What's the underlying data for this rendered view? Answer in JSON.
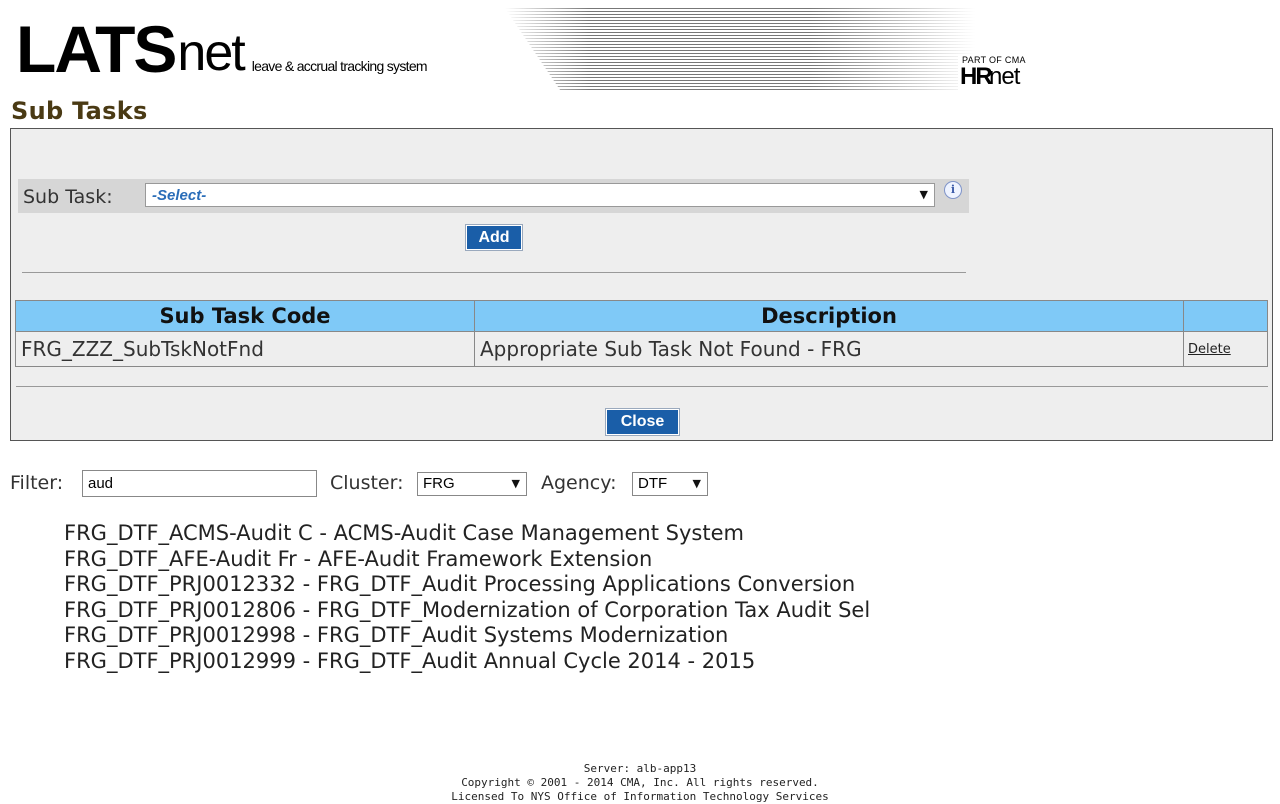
{
  "header": {
    "logo_lats": "LATS",
    "logo_net": "net",
    "tagline": "leave & accrual tracking system",
    "part_of": "PART OF CMA",
    "hr": "HR",
    "hr_net": "net"
  },
  "page_title": "Sub Tasks",
  "subtask": {
    "label": "Sub Task:",
    "selected": "-Select-",
    "add_button": "Add"
  },
  "table": {
    "columns": [
      "Sub Task Code",
      "Description",
      ""
    ],
    "rows": [
      {
        "code": "FRG_ZZZ_SubTskNotFnd",
        "description": "Appropriate Sub Task Not Found - FRG",
        "action": "Delete"
      }
    ]
  },
  "close_button": "Close",
  "filter": {
    "label": "Filter:",
    "value": "aud",
    "cluster_label": "Cluster:",
    "cluster_value": "FRG",
    "agency_label": "Agency:",
    "agency_value": "DTF"
  },
  "results": [
    "FRG_DTF_ACMS-Audit C - ACMS-Audit Case Management System",
    "FRG_DTF_AFE-Audit Fr - AFE-Audit Framework Extension",
    "FRG_DTF_PRJ0012332 - FRG_DTF_Audit Processing Applications Conversion",
    "FRG_DTF_PRJ0012806 - FRG_DTF_Modernization of Corporation Tax Audit Sel",
    "FRG_DTF_PRJ0012998 - FRG_DTF_Audit Systems Modernization",
    "FRG_DTF_PRJ0012999 - FRG_DTF_Audit Annual Cycle 2014 - 2015"
  ],
  "footer": {
    "server": "Server:  alb-app13",
    "copyright": "Copyright © 2001 - 2014 CMA, Inc. All rights reserved.",
    "licensed": "Licensed To NYS Office of Information Technology Services"
  },
  "colors": {
    "button_blue": "#1a5ea8",
    "header_row": "#7fc9f7",
    "title_brown": "#4a3a14",
    "panel_bg": "#eeeeee"
  }
}
